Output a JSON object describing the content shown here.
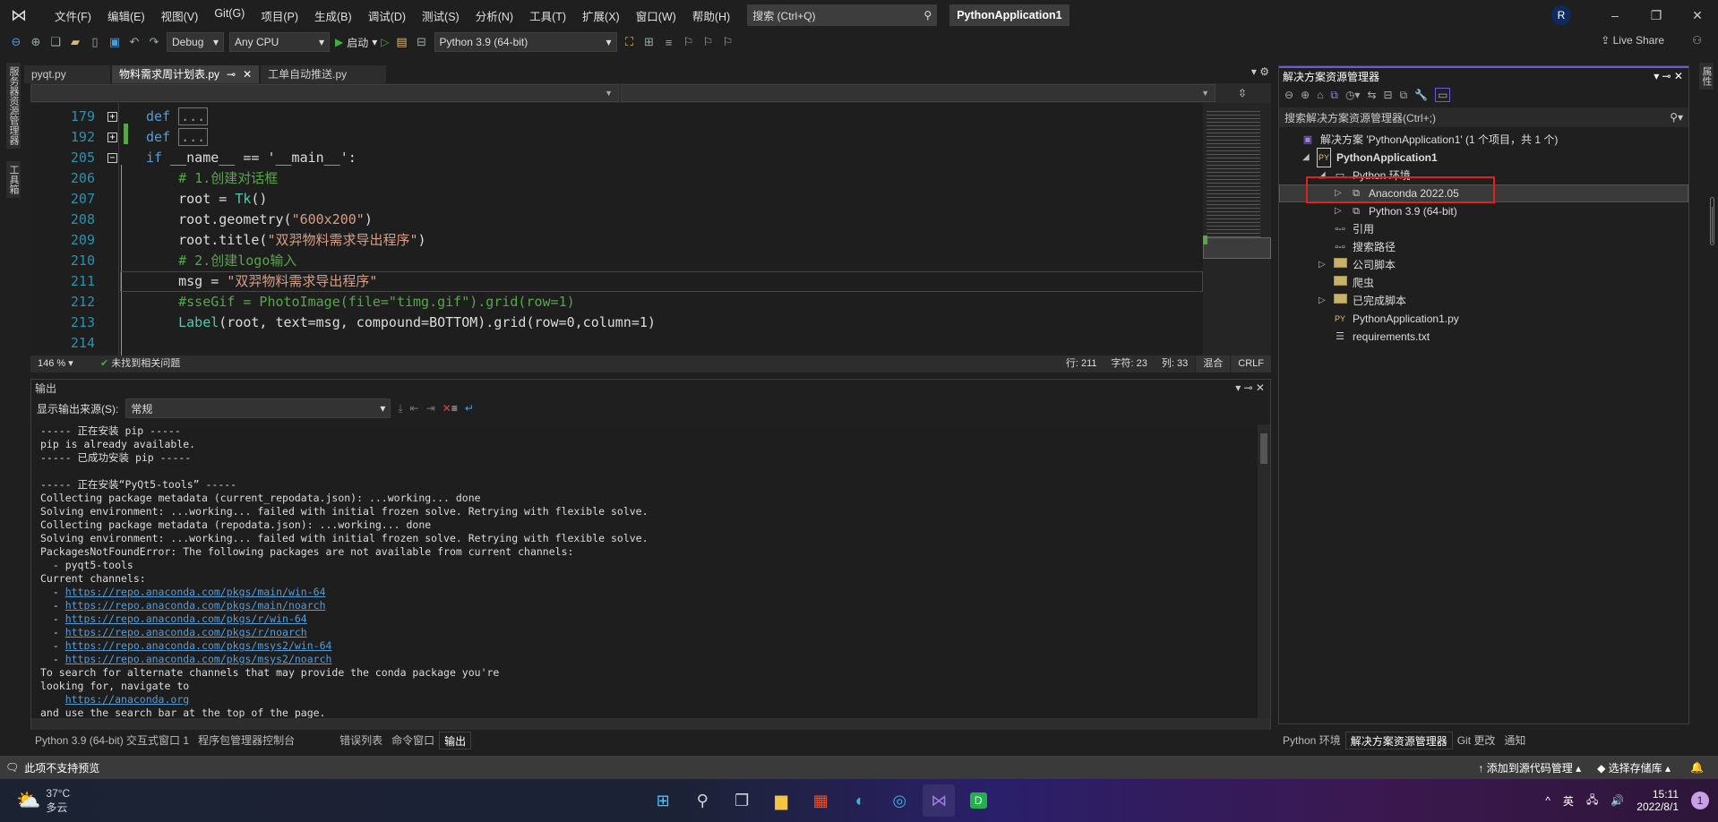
{
  "menubar": {
    "items": [
      "文件(F)",
      "编辑(E)",
      "视图(V)",
      "Git(G)",
      "项目(P)",
      "生成(B)",
      "调试(D)",
      "测试(S)",
      "分析(N)",
      "工具(T)",
      "扩展(X)",
      "窗口(W)",
      "帮助(H)"
    ],
    "search_placeholder": "搜索 (Ctrl+Q)",
    "app_title": "PythonApplication1",
    "avatar": "R"
  },
  "toolbar": {
    "config": "Debug",
    "platform": "Any CPU",
    "start": "启动",
    "environment": "Python 3.9 (64-bit)",
    "live_share": "Live Share"
  },
  "side_tabs": {
    "left": [
      "服务器资源管理器",
      "工具箱"
    ],
    "right": "属性"
  },
  "doc_tabs": [
    {
      "label": "pyqt.py",
      "active": false
    },
    {
      "label": "物料需求周计划表.py",
      "active": true
    },
    {
      "label": "工单自动推送.py",
      "active": false
    }
  ],
  "editor": {
    "lines": [
      {
        "num": "179",
        "tokens": [
          [
            "kw",
            "def "
          ],
          [
            "collapsed",
            "..."
          ]
        ],
        "fold": "+"
      },
      {
        "num": "192",
        "tokens": [
          [
            "kw",
            "def "
          ],
          [
            "collapsed",
            "..."
          ]
        ],
        "fold": "+"
      },
      {
        "num": "205",
        "tokens": [
          [
            "kw",
            "if "
          ],
          [
            "pl",
            "__name__ == '__main__':"
          ]
        ],
        "fold": "-"
      },
      {
        "num": "206",
        "tokens": [
          [
            "pl",
            "    "
          ],
          [
            "cm",
            "# 1.创建对话框"
          ]
        ]
      },
      {
        "num": "207",
        "tokens": [
          [
            "pl",
            "    root = "
          ],
          [
            "cls",
            "Tk"
          ],
          [
            "pl",
            "()"
          ]
        ]
      },
      {
        "num": "208",
        "tokens": [
          [
            "pl",
            "    root.geometry("
          ],
          [
            "str",
            "\"600x200\""
          ],
          [
            "pl",
            ")"
          ]
        ]
      },
      {
        "num": "209",
        "tokens": [
          [
            "pl",
            "    root.title("
          ],
          [
            "str",
            "\"双羿物料需求导出程序\""
          ],
          [
            "pl",
            ")"
          ]
        ]
      },
      {
        "num": "210",
        "tokens": [
          [
            "pl",
            "    "
          ],
          [
            "cm",
            "# 2.创建logo输入"
          ]
        ]
      },
      {
        "num": "211",
        "tokens": [
          [
            "pl",
            "    msg = "
          ],
          [
            "str",
            "\"双羿物料需求导出程序\""
          ]
        ],
        "current": true
      },
      {
        "num": "212",
        "tokens": [
          [
            "pl",
            "    "
          ],
          [
            "cm",
            "#sseGif = PhotoImage(file=\"timg.gif\").grid(row=1)"
          ]
        ]
      },
      {
        "num": "213",
        "tokens": [
          [
            "pl",
            "    "
          ],
          [
            "cls",
            "Label"
          ],
          [
            "pl",
            "(root, text=msg, compound=BOTTOM).grid(row=0,column=1)"
          ]
        ]
      },
      {
        "num": "214",
        "tokens": []
      }
    ],
    "status": {
      "zoom": "146 %",
      "issues": "未找到相关问题",
      "line": "行: 211",
      "char": "字符: 23",
      "col": "列: 33",
      "encoding": "混合",
      "eol": "CRLF"
    }
  },
  "output": {
    "title": "输出",
    "source_label": "显示输出来源(S):",
    "source_value": "常规",
    "lines": [
      {
        "t": "----- 正在安装 pip -----"
      },
      {
        "t": "pip is already available."
      },
      {
        "t": "----- 已成功安装 pip -----"
      },
      {
        "t": ""
      },
      {
        "t": "----- 正在安装“PyQt5-tools” -----"
      },
      {
        "t": "Collecting package metadata (current_repodata.json): ...working... done"
      },
      {
        "t": "Solving environment: ...working... failed with initial frozen solve. Retrying with flexible solve."
      },
      {
        "t": "Collecting package metadata (repodata.json): ...working... done"
      },
      {
        "t": "Solving environment: ...working... failed with initial frozen solve. Retrying with flexible solve."
      },
      {
        "t": "PackagesNotFoundError: The following packages are not available from current channels:"
      },
      {
        "t": "  - pyqt5-tools"
      },
      {
        "t": "Current channels:"
      },
      {
        "p": "  - ",
        "link": "https://repo.anaconda.com/pkgs/main/win-64"
      },
      {
        "p": "  - ",
        "link": "https://repo.anaconda.com/pkgs/main/noarch"
      },
      {
        "p": "  - ",
        "link": "https://repo.anaconda.com/pkgs/r/win-64"
      },
      {
        "p": "  - ",
        "link": "https://repo.anaconda.com/pkgs/r/noarch"
      },
      {
        "p": "  - ",
        "link": "https://repo.anaconda.com/pkgs/msys2/win-64"
      },
      {
        "p": "  - ",
        "link": "https://repo.anaconda.com/pkgs/msys2/noarch"
      },
      {
        "t": "To search for alternate channels that may provide the conda package you're"
      },
      {
        "t": "looking for, navigate to"
      },
      {
        "p": "    ",
        "link": "https://anaconda.org"
      },
      {
        "t": "and use the search bar at the top of the page."
      }
    ]
  },
  "bottom_tabs": [
    {
      "label": "Python 3.9 (64-bit) 交互式窗口 1",
      "active": false
    },
    {
      "label": "程序包管理器控制台",
      "active": false
    },
    {
      "label": "错误列表",
      "active": false
    },
    {
      "label": "命令窗口",
      "active": false
    },
    {
      "label": "输出",
      "active": true
    }
  ],
  "solution_explorer": {
    "title": "解决方案资源管理器",
    "search_placeholder": "搜索解决方案资源管理器(Ctrl+;)",
    "items": [
      {
        "label": "解决方案 'PythonApplication1' (1 个项目，共 1 个)",
        "icon": "solution-icon",
        "glyph": "▣",
        "indent": 0,
        "exp": ""
      },
      {
        "label": "PythonApplication1",
        "icon": "python-project-icon",
        "glyph": "PY",
        "indent": 1,
        "exp": "◢",
        "bold": true
      },
      {
        "label": "Python 环境",
        "icon": "environments-icon",
        "glyph": "▭",
        "indent": 2,
        "exp": "◢"
      },
      {
        "label": "Anaconda 2022.05",
        "icon": "environment-icon",
        "glyph": "⧉",
        "indent": 3,
        "exp": "▷",
        "selected": true
      },
      {
        "label": "Python 3.9 (64-bit)",
        "icon": "environment-icon",
        "glyph": "⧉",
        "indent": 3,
        "exp": "▷"
      },
      {
        "label": "引用",
        "icon": "references-icon",
        "glyph": "▫-▫",
        "indent": 2,
        "exp": ""
      },
      {
        "label": "搜索路径",
        "icon": "search-paths-icon",
        "glyph": "▫-▫",
        "indent": 2,
        "exp": ""
      },
      {
        "label": "公司脚本",
        "icon": "folder-icon",
        "glyph": "folder",
        "indent": 2,
        "exp": "▷"
      },
      {
        "label": "爬虫",
        "icon": "folder-icon",
        "glyph": "folder",
        "indent": 2,
        "exp": ""
      },
      {
        "label": "已完成脚本",
        "icon": "folder-icon",
        "glyph": "folder",
        "indent": 2,
        "exp": "▷"
      },
      {
        "label": "PythonApplication1.py",
        "icon": "python-file-icon",
        "glyph": "PY",
        "indent": 2,
        "exp": ""
      },
      {
        "label": "requirements.txt",
        "icon": "text-file-icon",
        "glyph": "☰",
        "indent": 2,
        "exp": ""
      }
    ],
    "tabs": [
      {
        "label": "Python 环境",
        "active": false
      },
      {
        "label": "解决方案资源管理器",
        "active": true
      },
      {
        "label": "Git 更改",
        "active": false
      },
      {
        "label": "通知",
        "active": false
      }
    ]
  },
  "statusbar": {
    "message": "此项不支持预览",
    "source_control": "添加到源代码管理",
    "repo": "选择存储库"
  },
  "taskbar": {
    "weather_temp": "37°C",
    "weather_desc": "多云",
    "ime": "英",
    "time": "15:11",
    "date": "2022/8/1",
    "notification_count": "1"
  },
  "colors": {
    "accent": "#6e5ad6",
    "highlight_box": "#e0211d",
    "link": "#569cd6"
  }
}
